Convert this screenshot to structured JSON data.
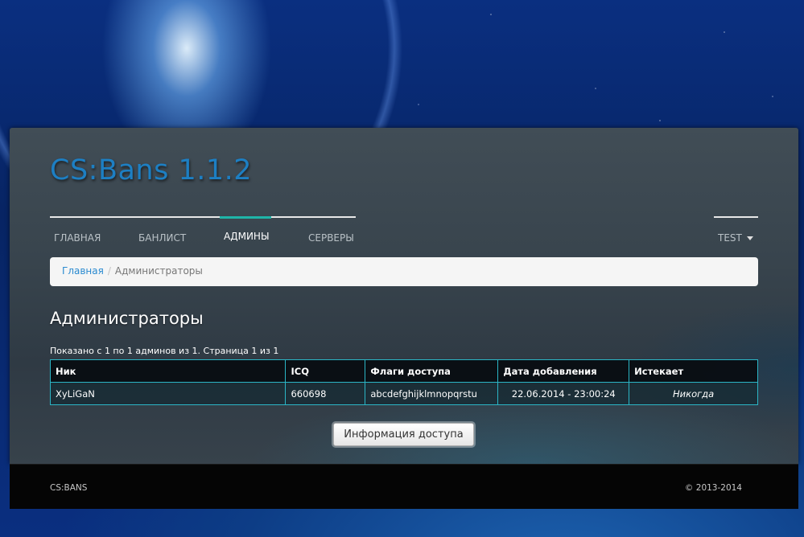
{
  "app": {
    "title": "CS:Bans 1.1.2"
  },
  "nav": {
    "items": [
      {
        "label": "ГЛАВНАЯ",
        "active": false
      },
      {
        "label": "БАНЛИСТ",
        "active": false
      },
      {
        "label": "АДМИНЫ",
        "active": true
      },
      {
        "label": "СЕРВЕРЫ",
        "active": false
      }
    ],
    "user": "TEST"
  },
  "breadcrumb": {
    "home": "Главная",
    "separator": "/",
    "current": "Администраторы"
  },
  "page": {
    "title": "Администраторы",
    "summary": "Показано с 1 по 1 админов из 1. Страница 1 из 1"
  },
  "table": {
    "headers": [
      "Ник",
      "ICQ",
      "Флаги доступа",
      "Дата добавления",
      "Истекает"
    ],
    "rows": [
      {
        "nick": "XyLiGaN",
        "icq": "660698",
        "flags": "abcdefghijklmnopqrstu",
        "date": "22.06.2014 - 23:00:24",
        "expires": "Никогда"
      }
    ]
  },
  "button": {
    "label": "Информация доступа"
  },
  "footer": {
    "left": "CS:BANS",
    "right": "© 2013-2014"
  },
  "colors": {
    "accent": "#1d7fc3",
    "nav_active": "#1fb5a8",
    "table_border": "#2bb6c6"
  }
}
